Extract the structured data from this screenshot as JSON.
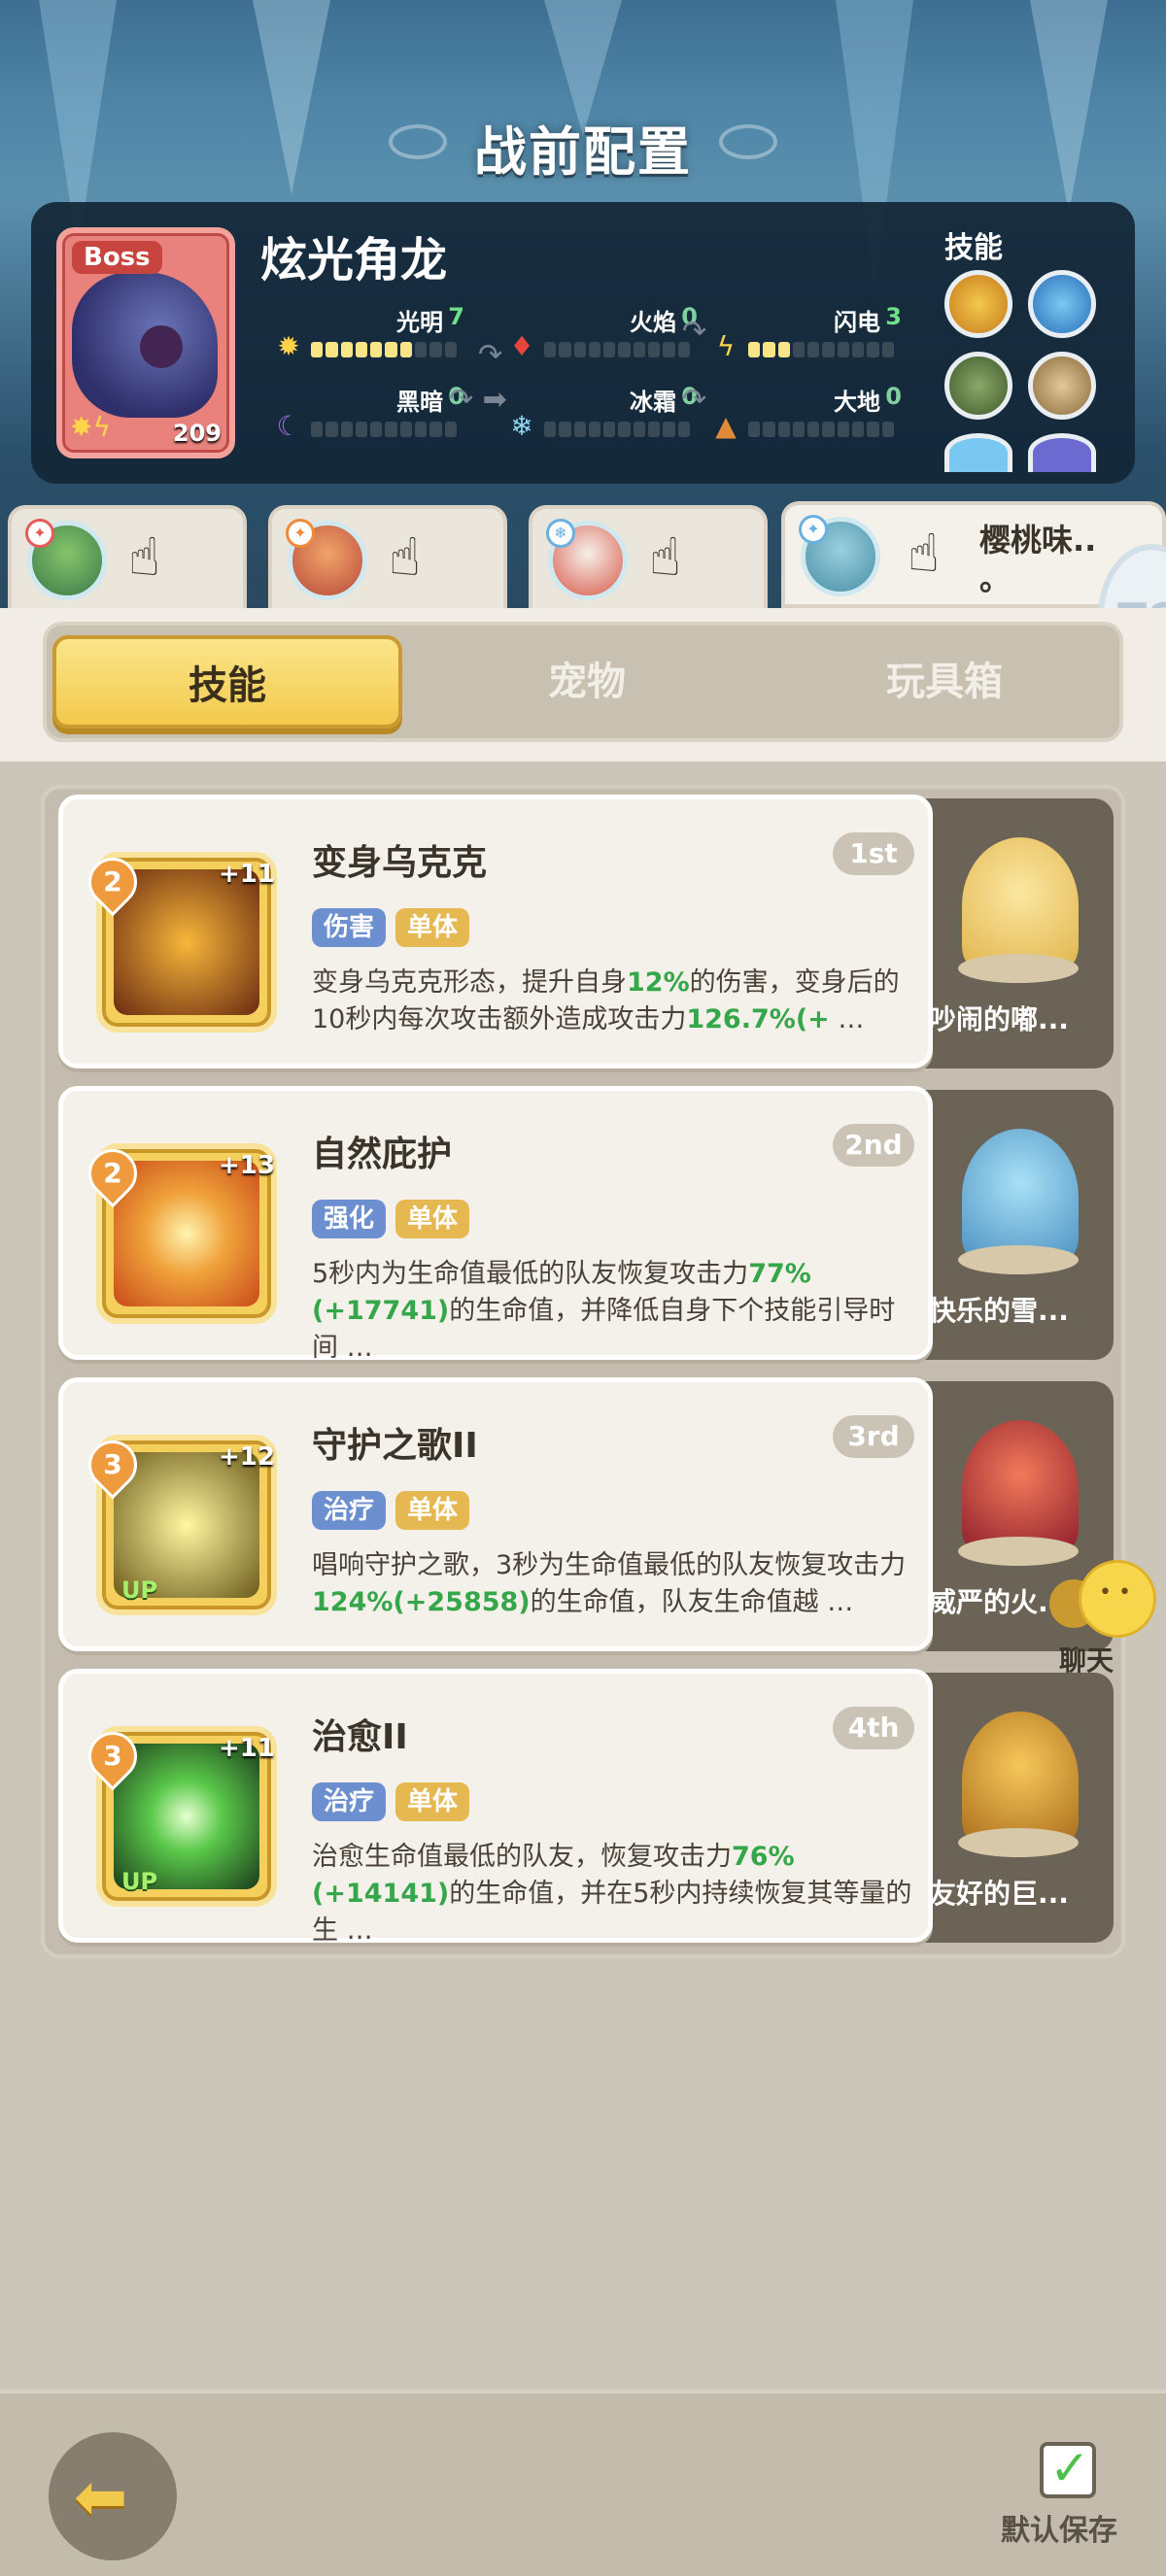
{
  "header": {
    "title": "战前配置"
  },
  "boss": {
    "tag": "Boss",
    "name": "炫光角龙",
    "level": "209",
    "stats": [
      {
        "label": "光明",
        "value": "7",
        "filled": 7
      },
      {
        "label": "火焰",
        "value": "0",
        "filled": 0
      },
      {
        "label": "闪电",
        "value": "3",
        "filled": 3
      },
      {
        "label": "黑暗",
        "value": "0",
        "filled": 0
      },
      {
        "label": "冰霜",
        "value": "0",
        "filled": 0
      },
      {
        "label": "大地",
        "value": "0",
        "filled": 0
      }
    ],
    "skills_label": "技能"
  },
  "hero_tabs": [
    {
      "name": "",
      "active": false
    },
    {
      "name": "",
      "active": false
    },
    {
      "name": "",
      "active": false
    },
    {
      "name": "樱桃味..\n。",
      "active": true
    }
  ],
  "tabs": [
    {
      "label": "技能",
      "active": true
    },
    {
      "label": "宠物",
      "active": false
    },
    {
      "label": "玩具箱",
      "active": false
    }
  ],
  "skills": [
    {
      "level": "2",
      "plus": "+11",
      "name": "变身乌克克",
      "rank": "1st",
      "tags": [
        "伤害",
        "单体"
      ],
      "desc_parts": [
        "变身乌克克形态，提升自身",
        "12%",
        "的伤害，变身后的10秒内每次攻击额外造成攻击力",
        "126.7%(+",
        " …"
      ],
      "pet_name": "吵闹的嘟..."
    },
    {
      "level": "2",
      "plus": "+13",
      "name": "自然庇护",
      "rank": "2nd",
      "tags": [
        "强化",
        "单体"
      ],
      "desc_parts": [
        "5秒内为生命值最低的队友恢复攻击力",
        "77%(+17741)",
        "的生命值，并降低自身下个技能引导时间",
        "",
        " …"
      ],
      "pet_name": "快乐的雪..."
    },
    {
      "level": "3",
      "plus": "+12",
      "name": "守护之歌II",
      "rank": "3rd",
      "tags": [
        "治疗",
        "单体"
      ],
      "desc_parts": [
        "唱响守护之歌，3秒为生命值最低的队友恢复攻击力",
        "124%(+25858)",
        "的生命值，队友生命值越",
        "",
        " …"
      ],
      "pet_name": "威严的火..."
    },
    {
      "level": "3",
      "plus": "+11",
      "name": "治愈II",
      "rank": "4th",
      "tags": [
        "治疗",
        "单体"
      ],
      "desc_parts": [
        "治愈生命值最低的队友，恢复攻击力",
        "76%(+14141)",
        "的生命值，并在5秒内持续恢复其等量的生",
        "",
        " …"
      ],
      "pet_name": "友好的巨..."
    }
  ],
  "chat": {
    "label": "聊天"
  },
  "bottom": {
    "save_label": "默认保存"
  },
  "colors": {
    "accent": "#f3c94c",
    "highlight_value": "#36a64a",
    "tag_blue": "#6c8fd0",
    "tag_gold": "#e5b852"
  }
}
